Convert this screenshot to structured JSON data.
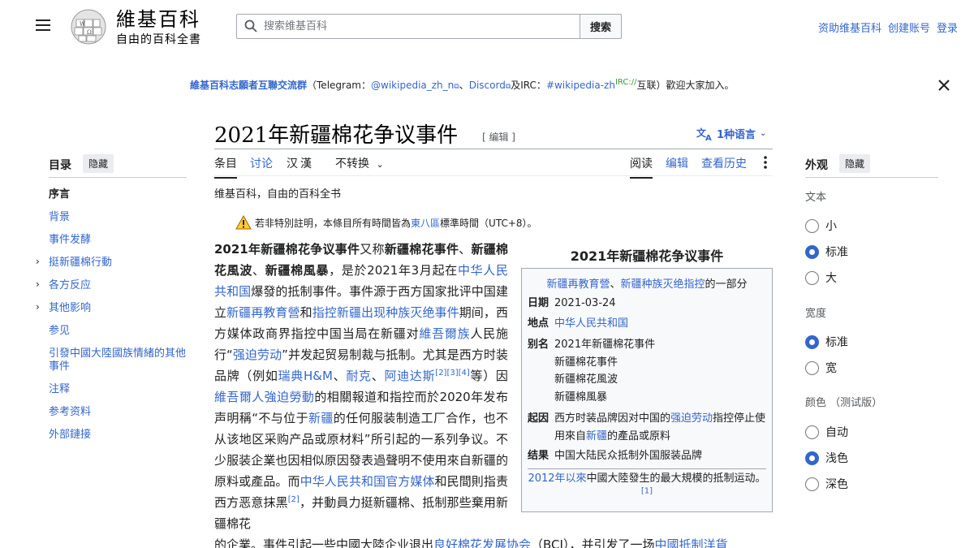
{
  "header": {
    "wordmark": "維基百科",
    "tagline": "自由的百科全書",
    "search_placeholder": "搜索维基百科",
    "search_button": "搜索",
    "user_links": [
      "资助维基百科",
      "创建账号",
      "登录"
    ]
  },
  "site_notice": {
    "group": "維基百科志願者互聯交流群",
    "p1": "（Telegram：",
    "telegram": "@wikipedia_zh_n",
    "sep1": "、",
    "discord": "Discord",
    "sep2": "及IRC：",
    "irc": "#wikipedia-zh",
    "irc_sup": "IRC://",
    "p2": "互联）歡迎大家加入。"
  },
  "title": {
    "text": "2021年新疆棉花争议事件",
    "edit": "[ 编辑 ]",
    "languages": "1种语言"
  },
  "tabs": {
    "left": [
      "条目",
      "讨论",
      "汉漢",
      "不转换"
    ],
    "right": [
      "阅读",
      "编辑",
      "查看历史"
    ]
  },
  "toc": {
    "title": "目录",
    "hide": "隐藏",
    "items": [
      "序言",
      "背景",
      "事件发酵",
      "挺新疆棉行動",
      "各方反应",
      "其他影响",
      "参见",
      "引發中國大陸國族情緒的其他事件",
      "注释",
      "参考资料",
      "外部鏈接"
    ]
  },
  "appearance": {
    "title": "外观",
    "hide": "隐藏",
    "text_head": "文本",
    "text_opts": [
      "小",
      "标准",
      "大"
    ],
    "width_head": "宽度",
    "width_opts": [
      "标准",
      "宽"
    ],
    "color_head": "颜色 （测试版）",
    "color_opts": [
      "自动",
      "浅色",
      "深色"
    ]
  },
  "content": {
    "from": "维基百科，自由的百科全书",
    "tz_a": "若非特別註明，本條目所有時間皆為",
    "tz_link": "東八區",
    "tz_b": "標準時間（UTC+8）。",
    "p": [
      "2021年新疆棉花争议事件",
      "又称",
      "新疆棉花事件",
      "、",
      "新疆棉花風波",
      "、",
      "新疆棉風暴",
      "，是於2021年3月起在",
      "中华人民共和国",
      "爆發的抵制事件。事件源于西方国家批评中国建立",
      "新疆再教育營",
      "和",
      "指控新疆出现种族灭绝事件",
      "期间，西方媒体政商界指控中国当局在新疆对",
      "維吾爾族",
      "人民施行“",
      "强迫劳动",
      "”并发起贸易制裁与抵制。尤其是西方时装品牌（例如",
      "瑞典",
      "H&M",
      "、",
      "耐克",
      "、",
      "阿迪达斯",
      "[2][3][4]",
      "等）因",
      "維吾爾人強迫勞動",
      "的相關報道和指控而於2020年发布声明稱“不与位于",
      "新疆",
      "的任何服装制造工厂合作，也不从该地区采购产品或原材料”所引起的一系列争议。不少服装企業也因相似原因發表過聲明不使用來自新疆的原料或產品。而",
      "中华人民共和国官方媒体",
      "和民間則指责西方恶意抹黑",
      "[2]",
      "，并動員力挺新疆棉、抵制那些棄用新疆棉花"
    ],
    "tail_a": "的企業。事件引起一些中國大陸企业退出",
    "tail_link1": "良好棉花发展协会",
    "tail_b": "（BCI），并引发了一场",
    "tail_link2": "中國抵制洋貨"
  },
  "infobox": {
    "title": "2021年新疆棉花争议事件",
    "part_link1": "新疆再教育營",
    "part_sep": "、",
    "part_link2": "新疆种族灭绝指控",
    "part_suffix": "的一部分",
    "date_label": "日期",
    "date": "2021-03-24",
    "place_label": "地点",
    "place": "中华人民共和国",
    "alias_label": "别名",
    "aliases": [
      "2021年新疆棉花事件",
      "新疆棉花事件",
      "新疆棉花風波",
      "新疆棉風暴"
    ],
    "cause_label": "起因",
    "cause_a": "西方时装品牌因对中国的",
    "cause_link1": "强迫劳动",
    "cause_b": "指控停止使用來自",
    "cause_link2": "新疆",
    "cause_c": "的產品或原料",
    "result_label": "结果",
    "result": "中国大陆民众抵制外国服装品牌",
    "foot_link": "2012年以來",
    "foot_a": "中國大陸發生的最大規模的抵制运动。",
    "foot_sup": "[1]"
  }
}
